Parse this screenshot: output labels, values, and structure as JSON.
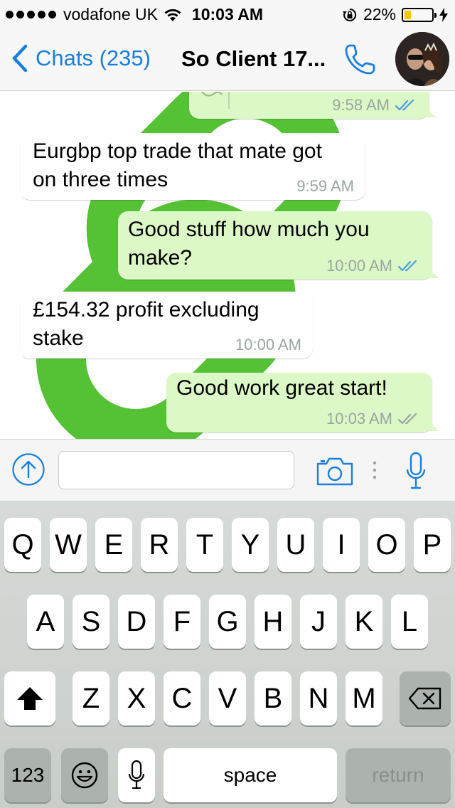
{
  "status_bar": {
    "carrier": "vodafone UK",
    "time": "10:03 AM",
    "battery_percent": "22%",
    "battery_level": 0.22,
    "signal_icon": "signal-dots-icon",
    "wifi_icon": "wifi-icon",
    "lock_icon": "rotation-lock-icon",
    "charging_icon": "charging-bolt-icon"
  },
  "nav": {
    "back_label": "Chats (235)",
    "contact_name": "So Client 17...",
    "call_icon": "phone-icon",
    "avatar_icon": "contact-avatar"
  },
  "colors": {
    "accent": "#1a7fdc",
    "outgoing_bubble": "#dcf8c6",
    "incoming_bubble": "#ffffff",
    "wallpaper_green": "#4bbf2a",
    "read_ticks": "#4a9fe0",
    "delivered_ticks": "#9aa5a0"
  },
  "messages": [
    {
      "direction": "outgoing",
      "text": "",
      "time": "9:58 AM",
      "status": "read"
    },
    {
      "direction": "incoming",
      "text": "Eurgbp top trade that mate got on three times",
      "time": "9:59 AM"
    },
    {
      "direction": "outgoing",
      "text": "Good stuff how much you make?",
      "time": "10:00 AM",
      "status": "read"
    },
    {
      "direction": "incoming",
      "text": "£154.32 profit excluding stake",
      "time": "10:00 AM"
    },
    {
      "direction": "outgoing",
      "text": "Good work great start!",
      "time": "10:03 AM",
      "status": "delivered"
    }
  ],
  "input_bar": {
    "attach_icon": "upload-arrow-icon",
    "message_value": "",
    "camera_icon": "camera-icon",
    "mic_icon": "microphone-icon"
  },
  "keyboard": {
    "row1": [
      "Q",
      "W",
      "E",
      "R",
      "T",
      "Y",
      "U",
      "I",
      "O",
      "P"
    ],
    "row2": [
      "A",
      "S",
      "D",
      "F",
      "G",
      "H",
      "J",
      "K",
      "L"
    ],
    "row3": [
      "Z",
      "X",
      "C",
      "V",
      "B",
      "N",
      "M"
    ],
    "shift_icon": "shift-arrow-icon",
    "backspace_icon": "backspace-icon",
    "numbers_label": "123",
    "emoji_icon": "emoji-icon",
    "dictation_icon": "microphone-icon",
    "space_label": "space",
    "return_label": "return"
  }
}
